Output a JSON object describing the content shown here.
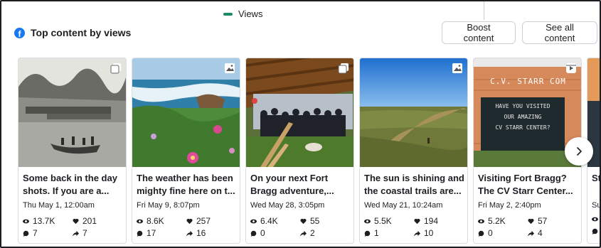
{
  "legend": {
    "label": "Views",
    "color": "#1b8a6b"
  },
  "header": {
    "title": "Top content by views",
    "icon": "facebook-icon"
  },
  "buttons": {
    "boost": "Boost content",
    "see_all": "See all content"
  },
  "cards": [
    {
      "caption": "Some back in the day shots. If you are a...",
      "date": "Thu May 1, 12:00am",
      "views": "13.7K",
      "likes": "201",
      "comments": "7",
      "shares": "7",
      "badge": "multi-photo-icon"
    },
    {
      "caption": "The weather has been mighty fine here on t...",
      "date": "Fri May 9, 8:07pm",
      "views": "8.6K",
      "likes": "257",
      "comments": "17",
      "shares": "16",
      "badge": "photo-icon"
    },
    {
      "caption": "On your next Fort Bragg adventure,...",
      "date": "Wed May 28, 3:05pm",
      "views": "6.4K",
      "likes": "55",
      "comments": "0",
      "shares": "2",
      "badge": "multi-photo-icon"
    },
    {
      "caption": "The sun is shining and the coastal trails are...",
      "date": "Wed May 21, 10:24am",
      "views": "5.5K",
      "likes": "194",
      "comments": "1",
      "shares": "10",
      "badge": "photo-icon"
    },
    {
      "caption": "Visiting Fort Bragg? The CV Starr Center...",
      "date": "Fri May 2, 2:40pm",
      "views": "5.2K",
      "likes": "57",
      "comments": "0",
      "shares": "4",
      "badge": "reel-icon"
    },
    {
      "caption": "St lo",
      "date": "Su",
      "views": "",
      "likes": "",
      "comments": "",
      "shares": "",
      "badge": ""
    }
  ],
  "sign": {
    "line1": "C.V. STARR COM",
    "line2": "HAVE YOU VISITED",
    "line3": "OUR AMAZING",
    "line4": "CV STARR CENTER?"
  },
  "next_icon": "chevron-right-icon"
}
